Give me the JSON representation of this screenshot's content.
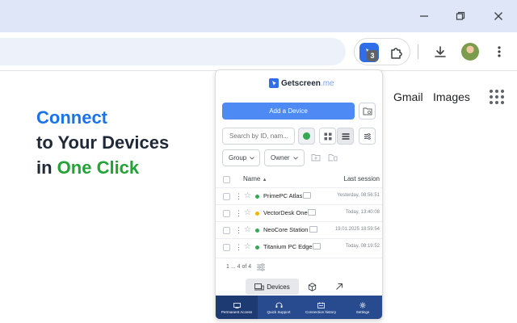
{
  "browser": {
    "extensions_badge_count": "3"
  },
  "google": {
    "gmail_label": "Gmail",
    "images_label": "Images"
  },
  "promo": {
    "line1": "Connect",
    "line2": "to Your Devices",
    "line3_prefix": "in ",
    "line3_highlight": "One Click"
  },
  "popup": {
    "logo_name": "Getscreen",
    "logo_domain": ".me",
    "add_device_label": "Add a Device",
    "search_placeholder": "Search by ID, nam...",
    "filters": {
      "group_label": "Group",
      "owner_label": "Owner"
    },
    "table": {
      "col_name": "Name",
      "col_last_session": "Last session",
      "rows": [
        {
          "name": "PrimePC Atlas",
          "status": "online",
          "last_session": "Yesterday, 08:56:51"
        },
        {
          "name": "VectorDesk One",
          "status": "away",
          "last_session": "Today, 13:40:08"
        },
        {
          "name": "NeoCore Station",
          "status": "online",
          "last_session": "19.01.2025 18:59:54"
        },
        {
          "name": "Titanium PC Edge",
          "status": "online",
          "last_session": "Today, 08:19:52"
        }
      ]
    },
    "pager_text": "1 ... 4 of 4",
    "segment_active_label": "Devices",
    "bottom_nav": [
      {
        "label": "Permanent Access",
        "icon": "monitor-icon",
        "active": true
      },
      {
        "label": "Quick Support",
        "icon": "headset-icon",
        "active": false
      },
      {
        "label": "Connection history",
        "icon": "history-icon",
        "active": false
      },
      {
        "label": "Settings",
        "icon": "gear-icon",
        "active": false
      }
    ]
  },
  "colors": {
    "accent_blue": "#4e8af4",
    "brand_blue": "#2f6ee8",
    "status_online": "#34a853",
    "status_away": "#f4b400",
    "nav_bg": "#284b8f",
    "promo_blue": "#1a73e8",
    "promo_green": "#22a336"
  }
}
